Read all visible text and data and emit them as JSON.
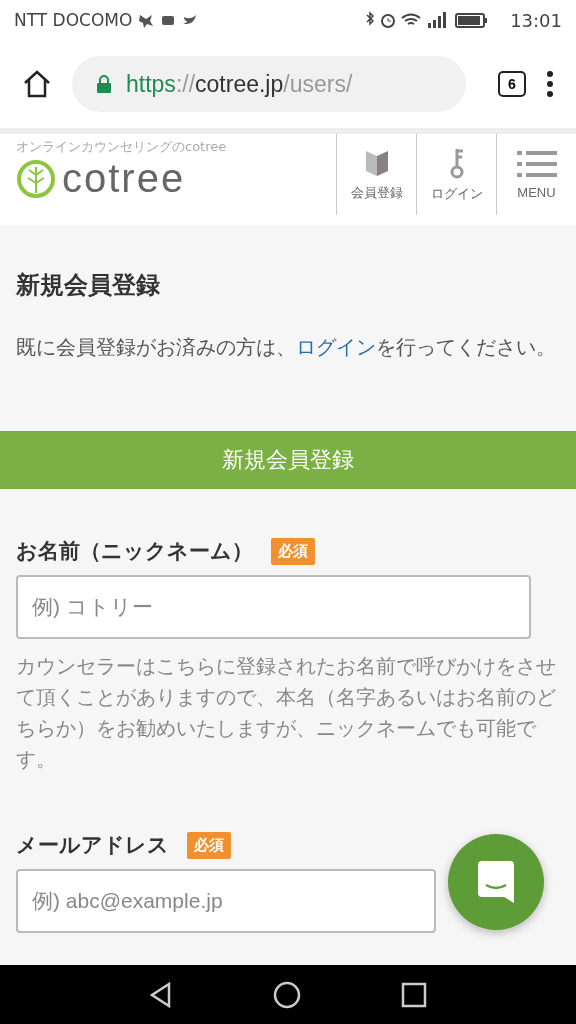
{
  "status_bar": {
    "carrier": "NTT DOCOMO",
    "time": "13:01"
  },
  "browser": {
    "url": {
      "scheme": "https",
      "separator": "://",
      "host": "cotree.jp",
      "path": "/users/"
    },
    "tab_count": "6"
  },
  "site_header": {
    "tagline": "オンラインカウンセリングのcotree",
    "logo_text": "cotree",
    "nav": [
      {
        "kind": "register",
        "label": "会員登録"
      },
      {
        "kind": "login",
        "label": "ログイン"
      },
      {
        "kind": "menu",
        "label": "MENU"
      }
    ]
  },
  "page": {
    "title": "新規会員登録",
    "intro_before": "既に会員登録がお済みの方は、",
    "intro_link": "ログイン",
    "intro_after": "を行ってください。"
  },
  "form": {
    "section_title": "新規会員登録",
    "fields": [
      {
        "label": "お名前（ニックネーム）",
        "badge": "必須",
        "placeholder": "例) コトリー",
        "help": "カウンセラーはこちらに登録されたお名前で呼びかけをさせて頂くことがありますので、本名（名字あるいはお名前のどちらか）をお勧めいたしますが、ニックネームでも可能です。"
      },
      {
        "label": "メールアドレス",
        "badge": "必須",
        "placeholder": "例) abc@example.jp"
      }
    ]
  }
}
